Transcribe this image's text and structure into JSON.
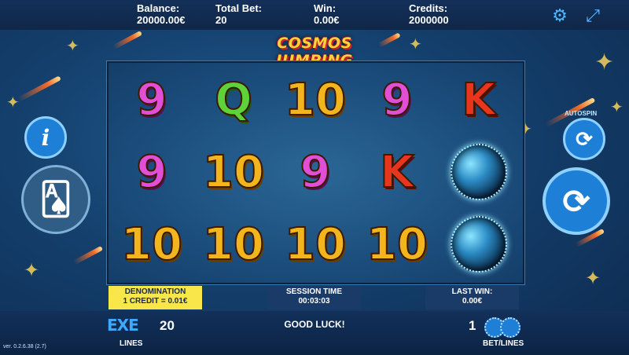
{
  "header": {
    "balance_label": "Balance:",
    "balance_value": "20000.00€",
    "totalbet_label": "Total Bet:",
    "totalbet_value": "20",
    "win_label": "Win:",
    "win_value": "0.00€",
    "credits_label": "Credits:",
    "credits_value": "2000000",
    "settings_icon": "gear-icon",
    "fullscreen_icon": "fullscreen-icon"
  },
  "logo_text": "COSMOS JUMPING",
  "reels": [
    [
      "9",
      "9",
      "10"
    ],
    [
      "Q",
      "10",
      "10"
    ],
    [
      "10",
      "9",
      "10"
    ],
    [
      "9",
      "K",
      "10"
    ],
    [
      "K",
      "ball",
      "ball"
    ]
  ],
  "buttons": {
    "info_icon": "info-icon",
    "gamble_icon": "cards-icon",
    "autospin_label": "AUTOSPIN",
    "autospin_icon": "refresh-icon",
    "spin_icon": "refresh-icon"
  },
  "panels": {
    "denomination_label": "DENOMINATION",
    "denomination_value": "1 CREDIT = 0.01€",
    "session_label": "SESSION TIME",
    "session_value": "00:03:03",
    "lastwin_label": "LAST WIN:",
    "lastwin_value": "0.00€"
  },
  "footer": {
    "lines_logo": "EXE",
    "lines_count": "20",
    "lines_label": "LINES",
    "status_message": "GOOD LUCK!",
    "bet_count": "1",
    "bet_label": "BET/LINES",
    "version": "ver. 0.2.6.38 (2.7)"
  },
  "colors": {
    "background": "#1b4d7c",
    "accent_blue": "#1e7fd6",
    "denomination_bg": "#f8e64a",
    "nine": "#e24fd6",
    "ten": "#f2b51e",
    "queen": "#5fd23a",
    "king": "#e8361e"
  }
}
